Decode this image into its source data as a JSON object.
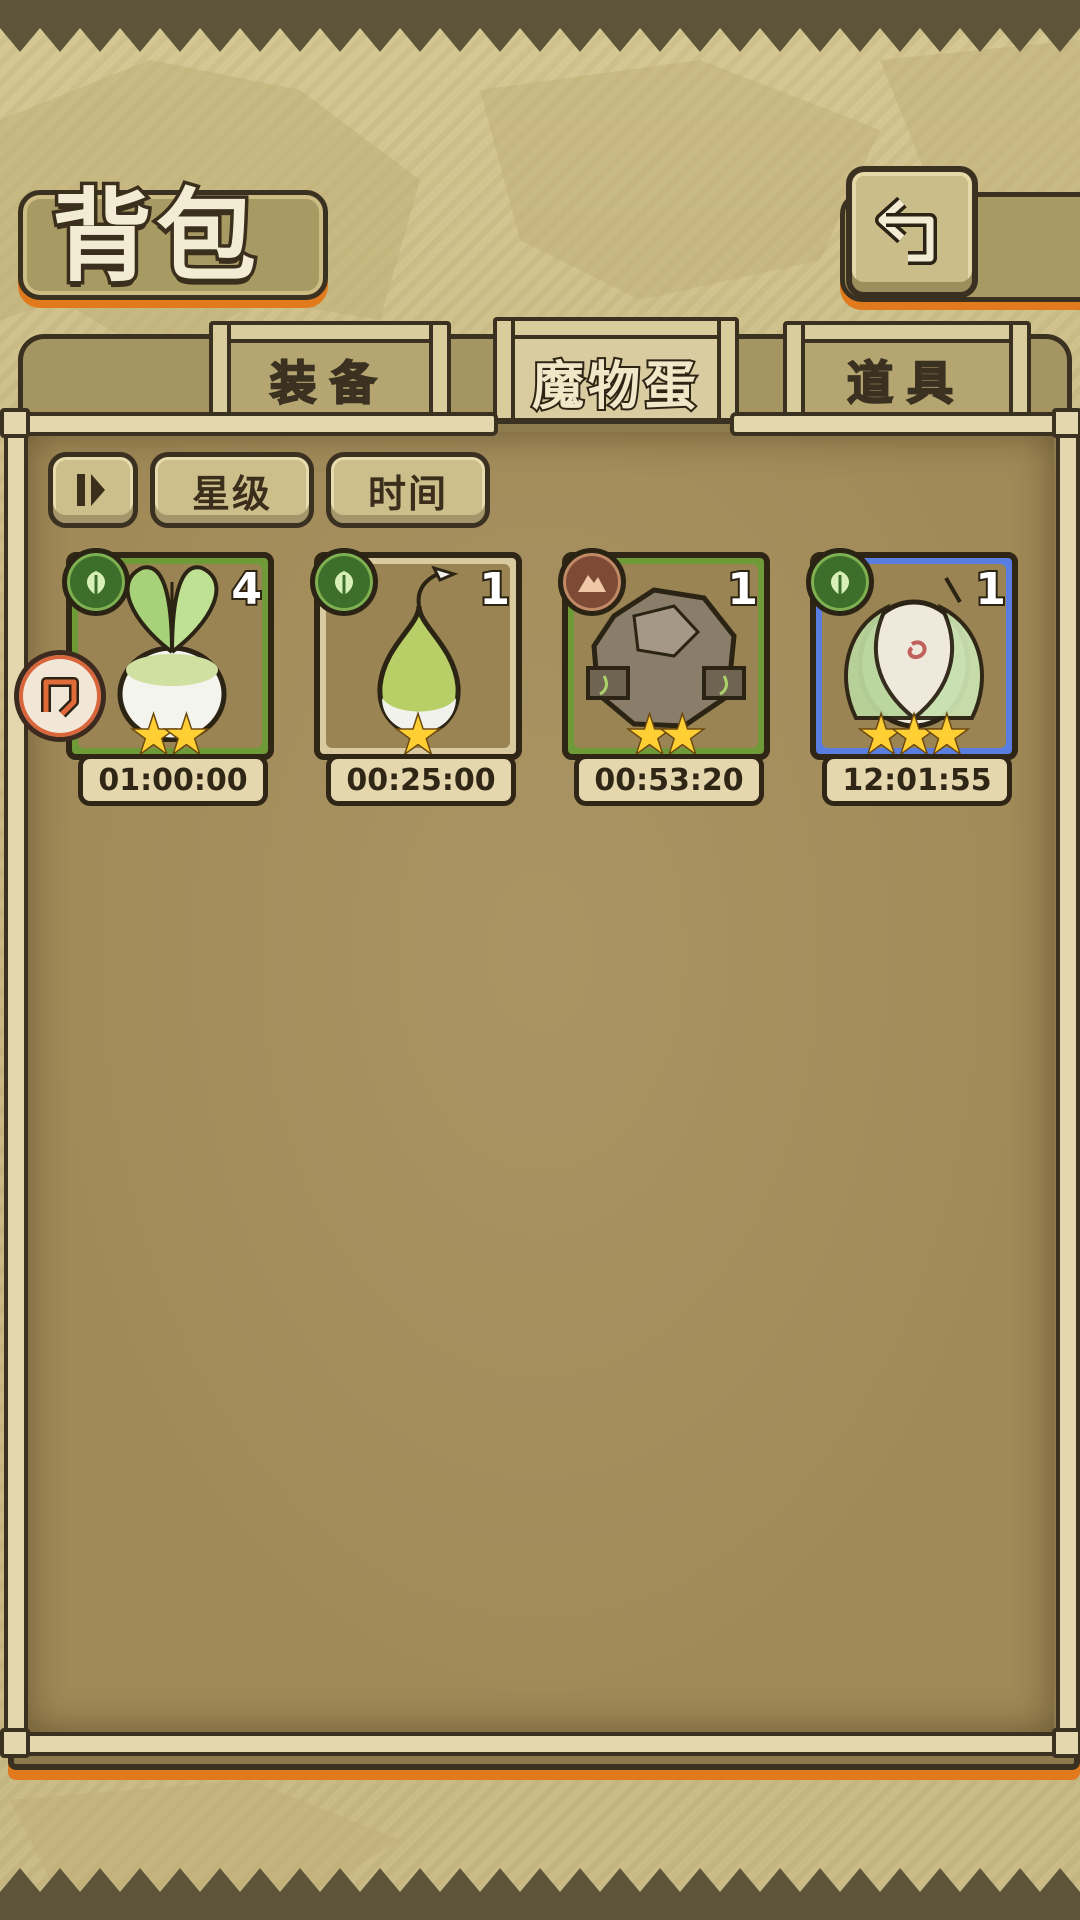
{
  "header": {
    "title": "背包"
  },
  "tabs": [
    {
      "label": "装备",
      "active": false
    },
    {
      "label": "魔物蛋",
      "active": true
    },
    {
      "label": "道具",
      "active": false
    }
  ],
  "sort_buttons": {
    "toggle_icon": "sort-toggle-icon",
    "stars_label": "星级",
    "time_label": "时间"
  },
  "eggs": [
    {
      "name": "turnip-egg",
      "element": "plant",
      "count": "4",
      "stars": 2,
      "frame": "green",
      "timer": "01:00:00"
    },
    {
      "name": "bulb-egg",
      "element": "plant",
      "count": "1",
      "stars": 1,
      "frame": "tan",
      "timer": "00:25:00"
    },
    {
      "name": "rock-egg",
      "element": "earth",
      "count": "1",
      "stars": 2,
      "frame": "green",
      "timer": "00:53:20"
    },
    {
      "name": "leaf-egg",
      "element": "plant",
      "count": "1",
      "stars": 3,
      "frame": "blue",
      "timer": "12:01:55"
    }
  ],
  "colors": {
    "accent_orange": "#e07a1d",
    "frame_green": "#6e9a38",
    "frame_blue": "#5a7ee0",
    "outline": "#3b3121"
  }
}
